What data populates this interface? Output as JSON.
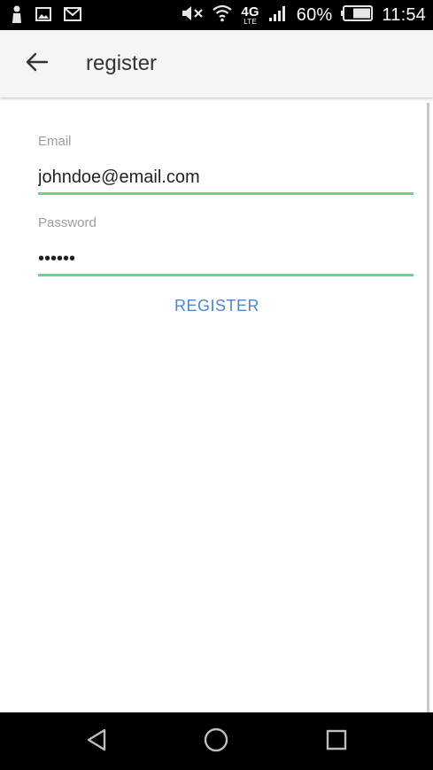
{
  "status_bar": {
    "network_label": "4G",
    "network_sub": "LTE",
    "battery": "60%",
    "time": "11:54",
    "icons": [
      "person-icon",
      "image-icon",
      "gmail-icon",
      "mute-icon",
      "wifi-icon",
      "signal-icon",
      "battery-icon"
    ]
  },
  "app_bar": {
    "title": "register",
    "back_icon": "arrow-left-icon"
  },
  "form": {
    "email_label": "Email",
    "email_value": "johndoe@email.com",
    "password_label": "Password",
    "password_value": "••••••",
    "register_label": "REGISTER"
  },
  "colors": {
    "underline": "#6fd08c",
    "button_text": "#4a86d4",
    "label": "#9e9e9e"
  },
  "nav_bar": {
    "icons": [
      "back-triangle-icon",
      "home-circle-icon",
      "recents-square-icon"
    ]
  }
}
